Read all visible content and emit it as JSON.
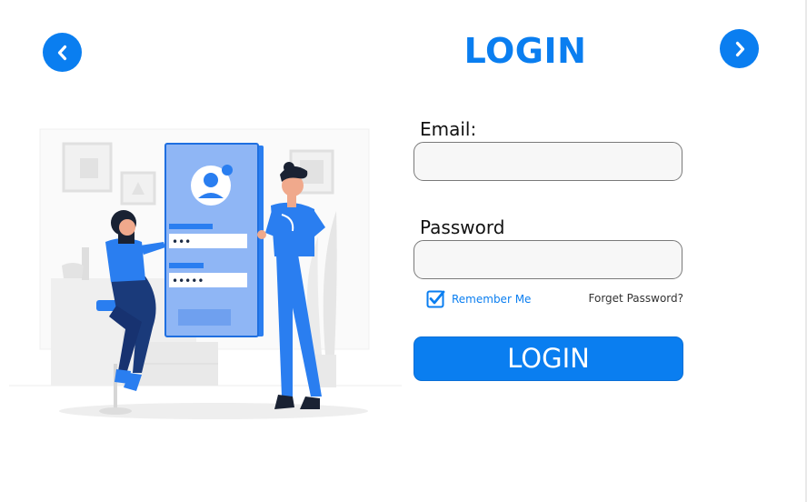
{
  "header": {
    "title": "LOGIN",
    "back_icon": "chevron-left-icon",
    "next_icon": "chevron-right-icon"
  },
  "form": {
    "email_label": "Email:",
    "email_value": "",
    "password_label": "Password",
    "password_value": "",
    "remember_label": "Remember Me",
    "remember_checked": true,
    "forgot_label": "Forget Password?",
    "submit_label": "LOGIN"
  },
  "illustration": {
    "password_mask_short": "•••",
    "password_mask_long": "•••••"
  },
  "colors": {
    "accent": "#0a7ef0",
    "field_bg": "#f7f7f7"
  }
}
